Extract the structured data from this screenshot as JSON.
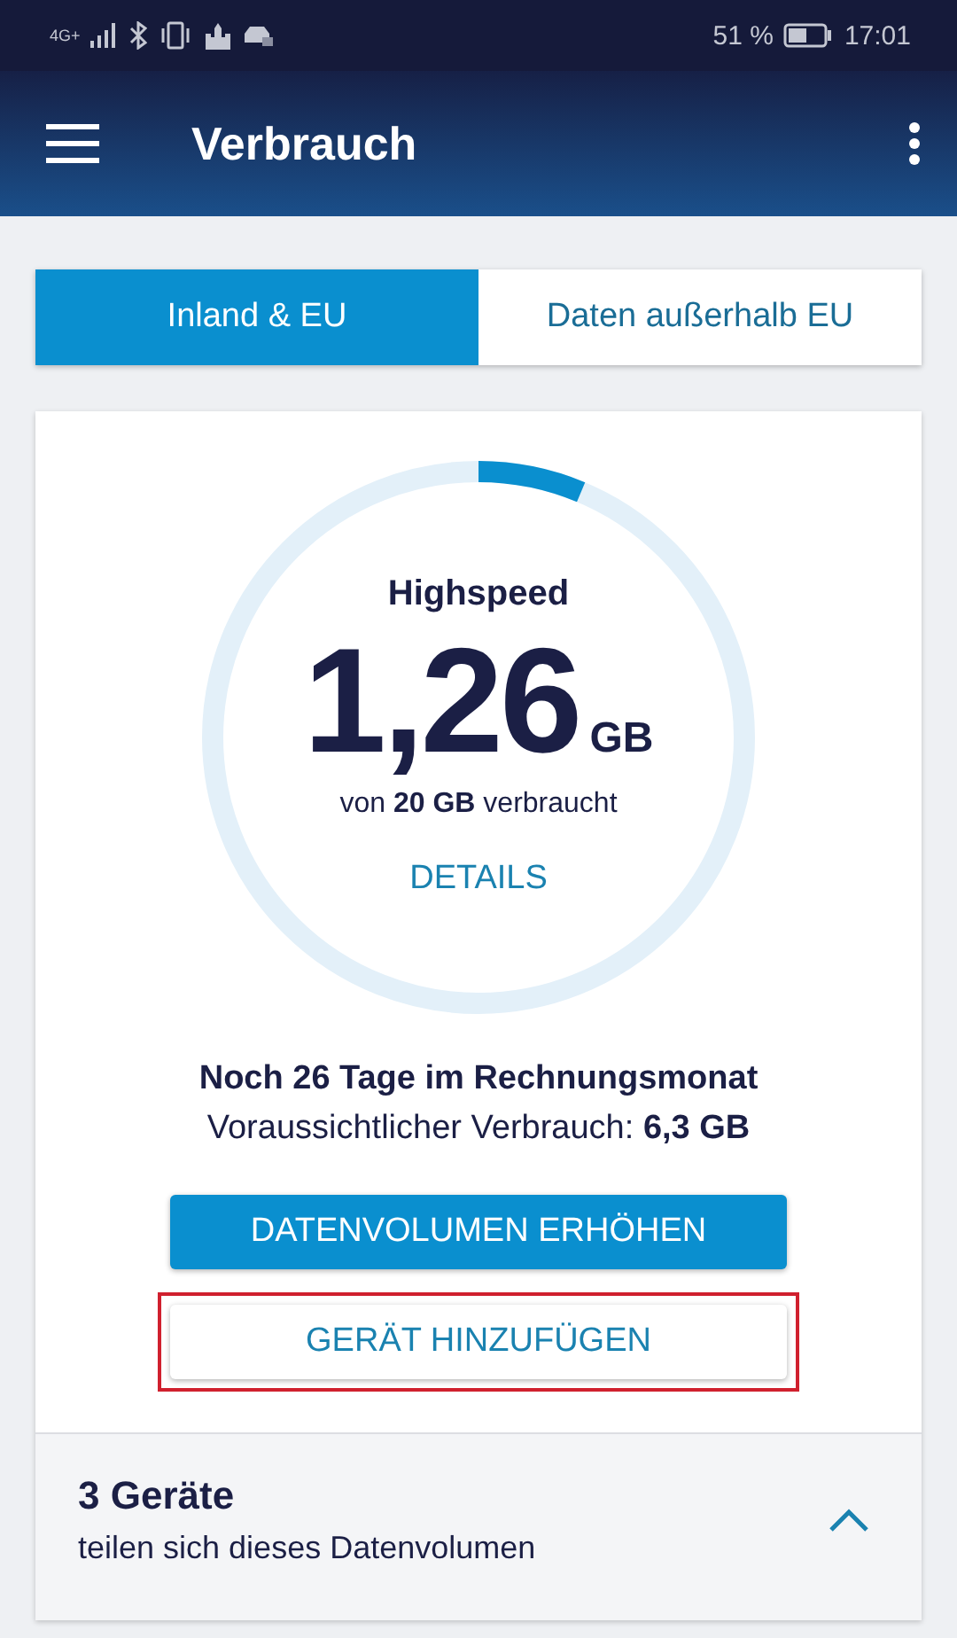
{
  "status_bar": {
    "network": "4G+",
    "battery": "51 %",
    "time": "17:01"
  },
  "app_bar": {
    "title": "Verbrauch"
  },
  "tabs": [
    {
      "label": "Inland & EU",
      "selected": true
    },
    {
      "label": "Daten außerhalb EU",
      "selected": false
    }
  ],
  "usage": {
    "caption": "Highspeed",
    "amount": "1,26",
    "unit": "GB",
    "subtitle": "von **20 GB** verbraucht",
    "details_link": "DETAILS"
  },
  "billing": {
    "remaining": "Noch 26 Tage im Rechnungsmonat",
    "forecast": "Voraussichtlicher Verbrauch: **6,3 GB**"
  },
  "buttons": [
    {
      "label": "DATENVOLUMEN ERHÖHEN",
      "kind": "primary",
      "highlighted": false
    },
    {
      "label": "GERÄT HINZUFÜGEN",
      "kind": "secondary",
      "highlighted": true
    }
  ],
  "devices": {
    "title": "3 Geräte",
    "subtitle": "teilen sich dieses Datenvolumen",
    "expanded": true
  }
}
